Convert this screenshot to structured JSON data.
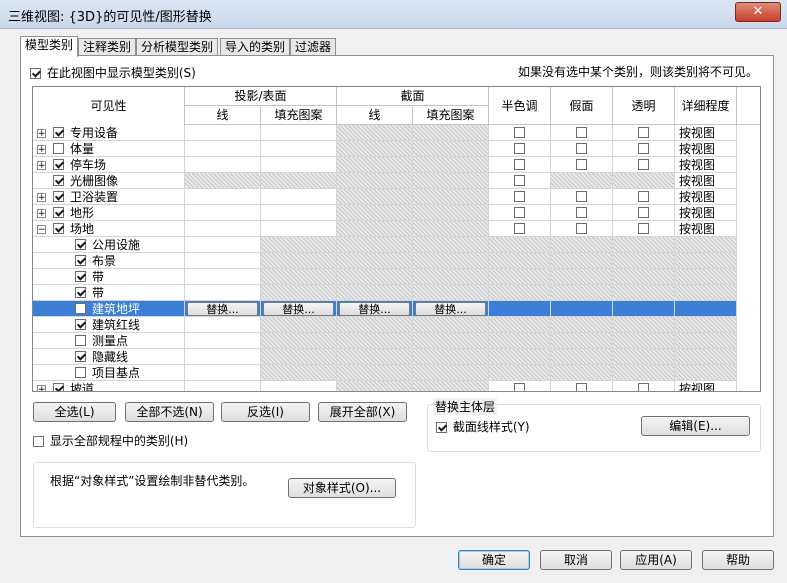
{
  "window": {
    "title": "三维视图: {3D}的可见性/图形替换",
    "close_label": "✕"
  },
  "tabs": [
    "模型类别",
    "注释类别",
    "分析模型类别",
    "导入的类别",
    "过滤器"
  ],
  "show_model_categories": {
    "label": "在此视图中显示模型类别(S)",
    "checked": true
  },
  "hint": "如果没有选中某个类别，则该类别将不可见。",
  "table": {
    "col_visibility": "可见性",
    "group_projection": "投影/表面",
    "group_cut": "截面",
    "sub_line": "线",
    "sub_fill": "填充图案",
    "col_halftone": "半色调",
    "col_ghost": "假面",
    "col_transparent": "透明",
    "col_detail": "详细程度",
    "override_label": "替换...",
    "rows": [
      {
        "label": "专用设备",
        "checked": true,
        "exp": "+",
        "detail": "按视图"
      },
      {
        "label": "体量",
        "checked": false,
        "exp": "+",
        "detail": "按视图"
      },
      {
        "label": "停车场",
        "checked": true,
        "exp": "+",
        "detail": "按视图"
      },
      {
        "label": "光栅图像",
        "checked": true,
        "exp": "",
        "detail": "按视图"
      },
      {
        "label": "卫浴装置",
        "checked": true,
        "exp": "+",
        "detail": "按视图"
      },
      {
        "label": "地形",
        "checked": true,
        "exp": "+",
        "detail": "按视图"
      },
      {
        "label": "场地",
        "checked": true,
        "exp": "-",
        "detail": "按视图"
      },
      {
        "label": "公用设施",
        "checked": true,
        "exp": "",
        "detail": ""
      },
      {
        "label": "布景",
        "checked": true,
        "exp": "",
        "detail": ""
      },
      {
        "label": "带",
        "checked": true,
        "exp": "",
        "detail": ""
      },
      {
        "label": "带",
        "checked": true,
        "exp": "",
        "detail": ""
      },
      {
        "label": "建筑地坪",
        "checked": false,
        "exp": "",
        "detail": ""
      },
      {
        "label": "建筑红线",
        "checked": true,
        "exp": "",
        "detail": ""
      },
      {
        "label": "测量点",
        "checked": false,
        "exp": "",
        "detail": ""
      },
      {
        "label": "隐藏线",
        "checked": true,
        "exp": "",
        "detail": ""
      },
      {
        "label": "项目基点",
        "checked": false,
        "exp": "",
        "detail": ""
      },
      {
        "label": "坡道",
        "checked": true,
        "exp": "+",
        "detail": "按视图"
      }
    ]
  },
  "buttons": {
    "select_all": "全选(L)",
    "select_none": "全部不选(N)",
    "invert": "反选(I)",
    "expand_all": "展开全部(X)"
  },
  "show_all_disciplines": {
    "label": "显示全部规程中的类别(H)",
    "checked": false
  },
  "host_layers": {
    "title": "替换主体层",
    "cut_line_label": "截面线样式(Y)",
    "cut_line_checked": true,
    "edit": "编辑(E)..."
  },
  "object_styles": {
    "text": "根据“对象样式”设置绘制非替代类别。",
    "button": "对象样式(O)..."
  },
  "footer": {
    "ok": "确定",
    "cancel": "取消",
    "apply": "应用(A)",
    "help": "帮助"
  }
}
